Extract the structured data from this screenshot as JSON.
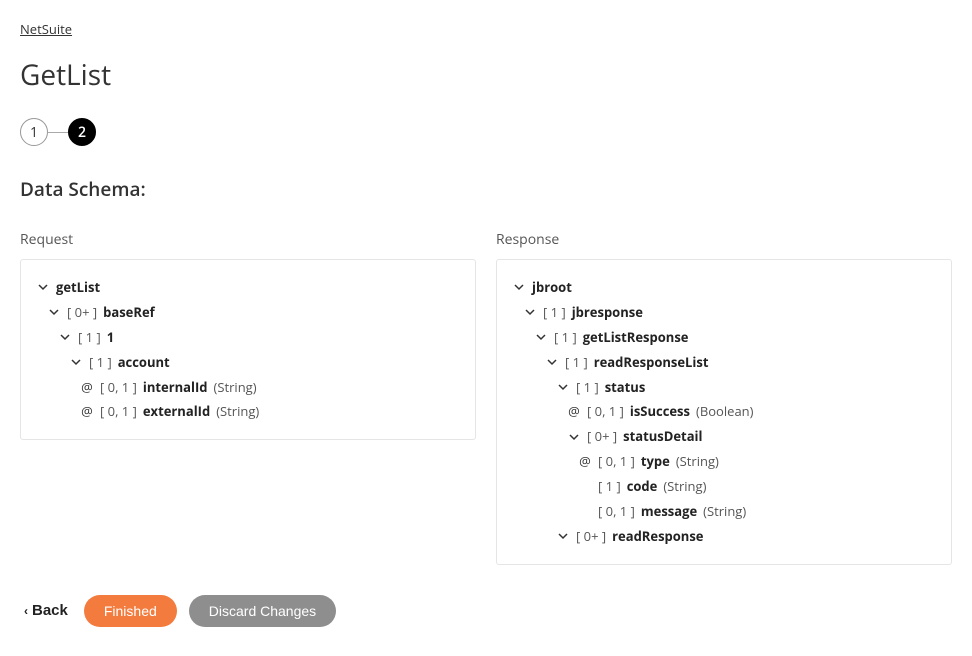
{
  "breadcrumb": {
    "label": "NetSuite"
  },
  "title": "GetList",
  "stepper": {
    "step1": "1",
    "step2": "2"
  },
  "section_title": "Data Schema:",
  "request_label": "Request",
  "response_label": "Response",
  "request_tree": [
    {
      "indent": 0,
      "chevron": true,
      "card": "",
      "name": "getList",
      "type": "",
      "at": false
    },
    {
      "indent": 1,
      "chevron": true,
      "card": "[ 0+ ]",
      "name": "baseRef",
      "type": "",
      "at": false
    },
    {
      "indent": 2,
      "chevron": true,
      "card": "[ 1 ]",
      "name": "1",
      "type": "",
      "at": false
    },
    {
      "indent": 3,
      "chevron": true,
      "card": "[ 1 ]",
      "name": "account",
      "type": "",
      "at": false
    },
    {
      "indent": 4,
      "chevron": false,
      "card": "[ 0, 1 ]",
      "name": "internalId",
      "type": "(String)",
      "at": true
    },
    {
      "indent": 4,
      "chevron": false,
      "card": "[ 0, 1 ]",
      "name": "externalId",
      "type": "(String)",
      "at": true
    }
  ],
  "response_tree": [
    {
      "indent": 0,
      "chevron": true,
      "card": "",
      "name": "jbroot",
      "type": "",
      "at": false
    },
    {
      "indent": 1,
      "chevron": true,
      "card": "[ 1 ]",
      "name": "jbresponse",
      "type": "",
      "at": false
    },
    {
      "indent": 2,
      "chevron": true,
      "card": "[ 1 ]",
      "name": "getListResponse",
      "type": "",
      "at": false
    },
    {
      "indent": 3,
      "chevron": true,
      "card": "[ 1 ]",
      "name": "readResponseList",
      "type": "",
      "at": false
    },
    {
      "indent": 4,
      "chevron": true,
      "card": "[ 1 ]",
      "name": "status",
      "type": "",
      "at": false
    },
    {
      "indent": 5,
      "chevron": false,
      "card": "[ 0, 1 ]",
      "name": "isSuccess",
      "type": "(Boolean)",
      "at": true
    },
    {
      "indent": 5,
      "chevron": true,
      "card": "[ 0+ ]",
      "name": "statusDetail",
      "type": "",
      "at": false
    },
    {
      "indent": 6,
      "chevron": false,
      "card": "[ 0, 1 ]",
      "name": "type",
      "type": "(String)",
      "at": true
    },
    {
      "indent": 6,
      "chevron": false,
      "card": "[ 1 ]",
      "name": "code",
      "type": "(String)",
      "at": false,
      "spacer": true
    },
    {
      "indent": 6,
      "chevron": false,
      "card": "[ 0, 1 ]",
      "name": "message",
      "type": "(String)",
      "at": false,
      "spacer": true
    },
    {
      "indent": 4,
      "chevron": true,
      "card": "[ 0+ ]",
      "name": "readResponse",
      "type": "",
      "at": false
    }
  ],
  "footer": {
    "back": "Back",
    "finished": "Finished",
    "discard": "Discard Changes"
  }
}
